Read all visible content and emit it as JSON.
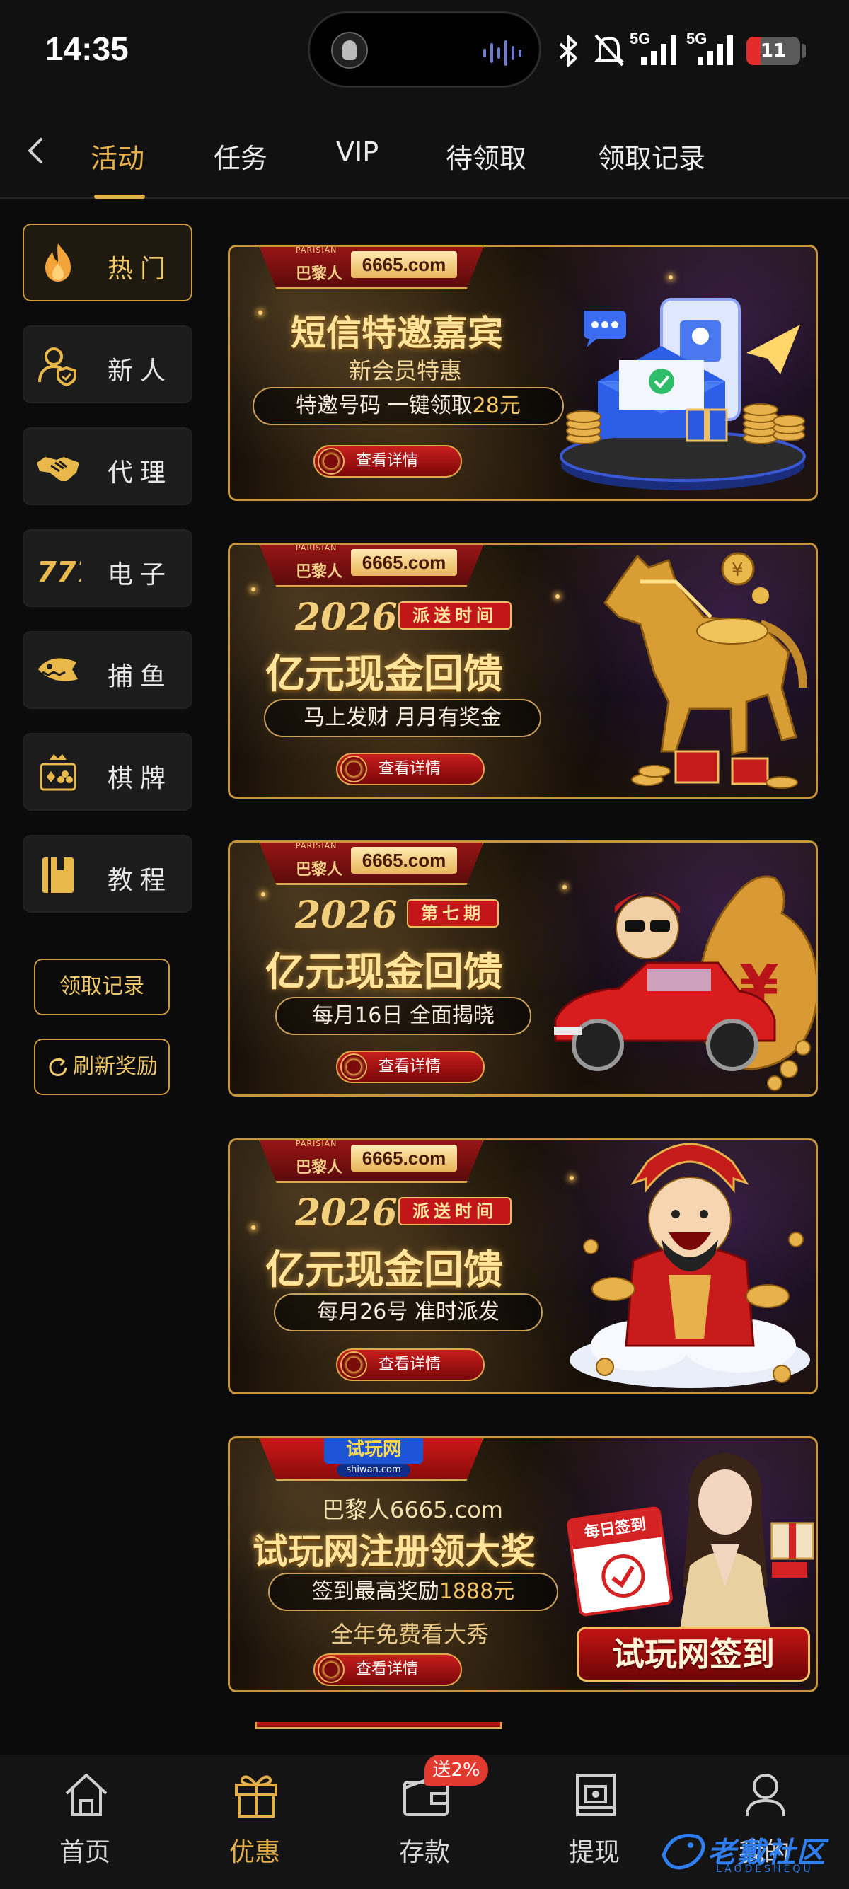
{
  "status_bar": {
    "time": "14:35",
    "signal_1": "5G",
    "signal_2": "5G",
    "battery": "11",
    "battery_level_percent": 11
  },
  "top_nav": {
    "tabs": [
      {
        "label": "活动",
        "active": true
      },
      {
        "label": "任务",
        "active": false
      },
      {
        "label": "VIP",
        "active": false
      },
      {
        "label": "待领取",
        "active": false
      },
      {
        "label": "领取记录",
        "active": false
      }
    ]
  },
  "sidebar": {
    "items": [
      {
        "label": "热门",
        "icon": "fire-icon",
        "active": true
      },
      {
        "label": "新人",
        "icon": "new-user-icon",
        "active": false
      },
      {
        "label": "代理",
        "icon": "handshake-icon",
        "active": false
      },
      {
        "label": "电子",
        "icon": "slot-777-icon",
        "active": false
      },
      {
        "label": "捕鱼",
        "icon": "fish-icon",
        "active": false
      },
      {
        "label": "棋牌",
        "icon": "cards-icon",
        "active": false
      },
      {
        "label": "教程",
        "icon": "book-icon",
        "active": false
      }
    ],
    "records_button": "领取记录",
    "refresh_button": "刷新奖励"
  },
  "banners": [
    {
      "logo_sub": "PARISIAN",
      "logo_brand": "巴黎人",
      "logo_domain": "6665.com",
      "title": "短信特邀嘉宾",
      "subtitle": "新会员特惠",
      "pill_main": "特邀号码 一键领取",
      "pill_highlight": "28元",
      "detail_button": "查看详情"
    },
    {
      "logo_sub": "PARISIAN",
      "logo_brand": "巴黎人",
      "logo_domain": "6665.com",
      "year": "2026",
      "tag": "派送时间",
      "title": "亿元现金回馈",
      "pill_main": "马上发财 月月有奖金",
      "detail_button": "查看详情"
    },
    {
      "logo_sub": "PARISIAN",
      "logo_brand": "巴黎人",
      "logo_domain": "6665.com",
      "year": "2026",
      "tag": "第七期",
      "title": "亿元现金回馈",
      "pill_main": "每月16日 全面揭晓",
      "detail_button": "查看详情"
    },
    {
      "logo_sub": "PARISIAN",
      "logo_brand": "巴黎人",
      "logo_domain": "6665.com",
      "year": "2026",
      "tag": "派送时间",
      "title": "亿元现金回馈",
      "pill_main": "每月26号 准时派发",
      "detail_button": "查看详情"
    },
    {
      "logo_brand": "试玩网",
      "logo_domain_small": "shiwan.com",
      "top_line": "巴黎人6665.com",
      "title": "试玩网注册领大奖",
      "pill_main": "签到最高奖励",
      "pill_highlight": "1888元",
      "subtitle": "全年免费看大秀",
      "checkin_card": "每日签到",
      "big_label": "试玩网签到",
      "detail_button": "查看详情"
    }
  ],
  "bottom_nav": {
    "items": [
      {
        "label": "首页",
        "icon": "home-icon",
        "active": false
      },
      {
        "label": "优惠",
        "icon": "gift-icon",
        "active": true
      },
      {
        "label": "存款",
        "icon": "wallet-icon",
        "active": false
      },
      {
        "label": "提现",
        "icon": "withdraw-icon",
        "active": false
      },
      {
        "label": "我的",
        "icon": "user-icon",
        "active": false
      }
    ],
    "deposit_badge": "送2%"
  },
  "watermark": {
    "text": "老戴社区",
    "sub": "LAODESHEQU"
  },
  "colors": {
    "accent_gold": "#e3b04b",
    "background": "#0b0b0b",
    "panel": "#1c1c1c",
    "badge_red": "#e23a2e"
  }
}
